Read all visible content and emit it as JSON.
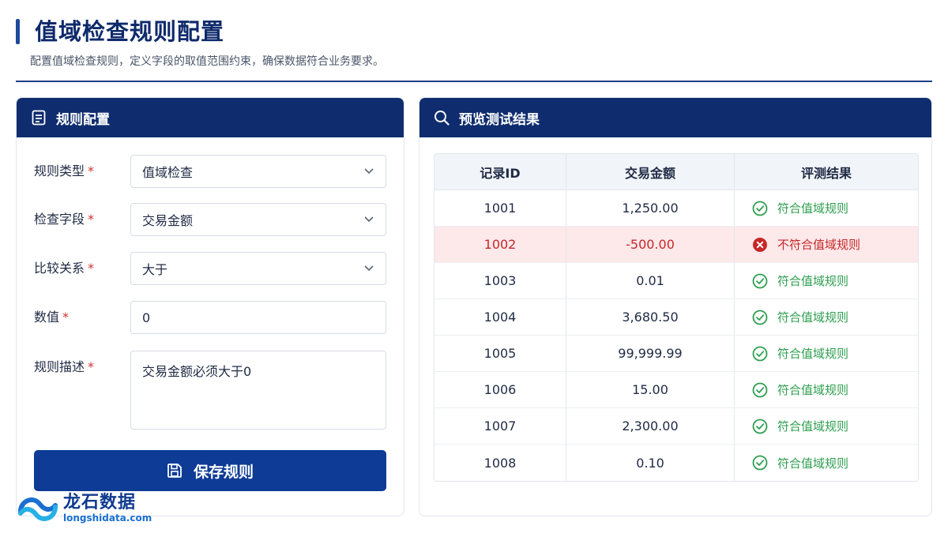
{
  "header": {
    "title": "值域检查规则配置",
    "subtitle": "配置值域检查规则，定义字段的取值范围约束，确保数据符合业务要求。"
  },
  "left_panel": {
    "title": "规则配置",
    "icon": "document-icon",
    "fields": {
      "rule_type": {
        "label": "规则类型",
        "required": "*",
        "value": "值域检查"
      },
      "check_field": {
        "label": "检查字段",
        "required": "*",
        "value": "交易金额"
      },
      "comparison": {
        "label": "比较关系",
        "required": "*",
        "value": "大于"
      },
      "number": {
        "label": "数值",
        "required": "*",
        "value": "0"
      },
      "description": {
        "label": "规则描述",
        "required": "*",
        "value": "交易金额必须大于0"
      }
    },
    "save_label": "保存规则"
  },
  "right_panel": {
    "title": "预览测试结果",
    "icon": "search-icon",
    "columns": [
      "记录ID",
      "交易金额",
      "评测结果"
    ],
    "rows": [
      {
        "id": "1001",
        "amount": "1,250.00",
        "result": "符合值域规则",
        "status": "pass"
      },
      {
        "id": "1002",
        "amount": "-500.00",
        "result": "不符合值域规则",
        "status": "fail"
      },
      {
        "id": "1003",
        "amount": "0.01",
        "result": "符合值域规则",
        "status": "pass"
      },
      {
        "id": "1004",
        "amount": "3,680.50",
        "result": "符合值域规则",
        "status": "pass"
      },
      {
        "id": "1005",
        "amount": "99,999.99",
        "result": "符合值域规则",
        "status": "pass"
      },
      {
        "id": "1006",
        "amount": "15.00",
        "result": "符合值域规则",
        "status": "pass"
      },
      {
        "id": "1007",
        "amount": "2,300.00",
        "result": "符合值域规则",
        "status": "pass"
      },
      {
        "id": "1008",
        "amount": "0.10",
        "result": "符合值域规则",
        "status": "pass"
      }
    ]
  },
  "logo": {
    "name": "龙石数据",
    "url": "longshidata.com"
  },
  "colors": {
    "primary": "#0f2d6e",
    "button": "#0d3b96",
    "pass": "#2e9e4f",
    "fail": "#c62828",
    "fail_bg": "#fde8ea"
  }
}
